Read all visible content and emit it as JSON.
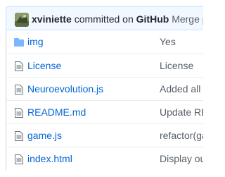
{
  "commit": {
    "author": "xviniette",
    "verb": "committed on",
    "site": "GitHub",
    "message": "Merge pull"
  },
  "colors": {
    "link": "#0366d6",
    "muted": "#586069",
    "commit_bg": "#f1f8ff",
    "folder_icon": "#79b8ff"
  },
  "files": [
    {
      "name": "img",
      "icon": "folder-icon",
      "message": "Yes"
    },
    {
      "name": "License",
      "icon": "file-icon",
      "message": "License"
    },
    {
      "name": "Neuroevolution.js",
      "icon": "file-icon",
      "message": "Added all"
    },
    {
      "name": "README.md",
      "icon": "file-icon",
      "message": "Update RE"
    },
    {
      "name": "game.js",
      "icon": "file-icon",
      "message": "refactor(ga"
    },
    {
      "name": "index.html",
      "icon": "file-icon",
      "message": "Display ou"
    }
  ]
}
